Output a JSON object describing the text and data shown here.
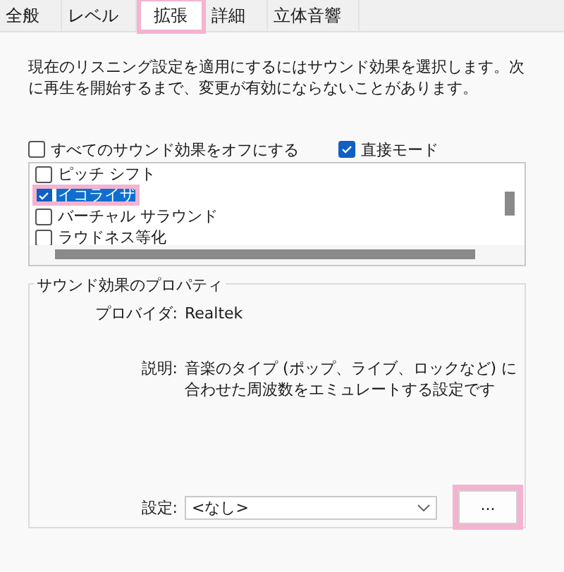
{
  "tabs": [
    {
      "label": "全般",
      "selected": false,
      "highlight": false
    },
    {
      "label": "レベル",
      "selected": false,
      "highlight": false
    },
    {
      "label": "拡張",
      "selected": true,
      "highlight": true
    },
    {
      "label": "詳細",
      "selected": false,
      "highlight": false
    },
    {
      "label": "立体音響",
      "selected": false,
      "highlight": false
    }
  ],
  "intro": "現在のリスニング設定を適用にするにはサウンド効果を選択します。次に再生を開始するまで、変更が有効にならないことがあります。",
  "options": [
    {
      "label": "すべてのサウンド効果をオフにする",
      "checked": false
    },
    {
      "label": "直接モード",
      "checked": true
    }
  ],
  "effects": [
    {
      "label": "ピッチ シフト",
      "checked": false,
      "selected": false,
      "highlight": false
    },
    {
      "label": "イコライザ",
      "checked": true,
      "selected": true,
      "highlight": true
    },
    {
      "label": "バーチャル サラウンド",
      "checked": false,
      "selected": false,
      "highlight": false
    },
    {
      "label": "ラウドネス等化",
      "checked": false,
      "selected": false,
      "highlight": false
    }
  ],
  "properties": {
    "title": "サウンド効果のプロパティ",
    "provider_label": "プロバイダ:",
    "provider": "Realtek",
    "description_label": "説明:",
    "description": "音楽のタイプ (ポップ、ライブ、ロックなど) に合わせた周波数をエミュレートする設定です",
    "setting_label": "設定:",
    "setting": "<なし>",
    "more_button": {
      "label": "...",
      "highlight": true
    }
  }
}
